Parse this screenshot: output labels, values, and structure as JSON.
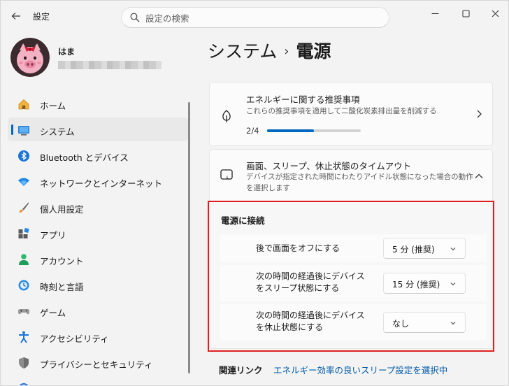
{
  "titlebar": {
    "app_title": "設定",
    "search_placeholder": "設定の検索"
  },
  "profile": {
    "name": "はま"
  },
  "sidebar": {
    "items": [
      {
        "label": "ホーム",
        "icon": "home-icon"
      },
      {
        "label": "システム",
        "icon": "display-icon",
        "selected": true
      },
      {
        "label": "Bluetooth とデバイス",
        "icon": "bluetooth-icon"
      },
      {
        "label": "ネットワークとインターネット",
        "icon": "wifi-icon"
      },
      {
        "label": "個人用設定",
        "icon": "brush-icon"
      },
      {
        "label": "アプリ",
        "icon": "apps-icon"
      },
      {
        "label": "アカウント",
        "icon": "person-icon"
      },
      {
        "label": "時刻と言語",
        "icon": "clock-globe-icon"
      },
      {
        "label": "ゲーム",
        "icon": "gamepad-icon"
      },
      {
        "label": "アクセシビリティ",
        "icon": "accessibility-icon"
      },
      {
        "label": "プライバシーとセキュリティ",
        "icon": "shield-icon"
      }
    ]
  },
  "breadcrumb": {
    "parent": "システム",
    "separator": "›",
    "current": "電源"
  },
  "recommendations": {
    "title": "エネルギーに関する推奨事項",
    "description": "これらの推奨事項を適用して二酸化炭素排出量を削減する",
    "progress_text": "2/4",
    "progress": 0.5
  },
  "timeout": {
    "title": "画面、スリープ、休止状態のタイムアウト",
    "description_line1": "デバイスが指定された時間にわたりアイドル状態になった場合の動作",
    "description_line2": "を選択します"
  },
  "plugged_in": {
    "title": "電源に接続",
    "rows": [
      {
        "label_line1": "後で画面をオフにする",
        "label_line2": "",
        "value": "5 分 (推奨)"
      },
      {
        "label_line1": "次の時間の経過後にデバイス",
        "label_line2": "をスリープ状態にする",
        "value": "15 分 (推奨)"
      },
      {
        "label_line1": "次の時間の経過後にデバイス",
        "label_line2": "を休止状態にする",
        "value": "なし"
      }
    ]
  },
  "related": {
    "label": "関連リンク",
    "link": "エネルギー効率の良いスリープ設定を選択中"
  },
  "colors": {
    "accent": "#0067c0",
    "highlight": "#e02020"
  }
}
